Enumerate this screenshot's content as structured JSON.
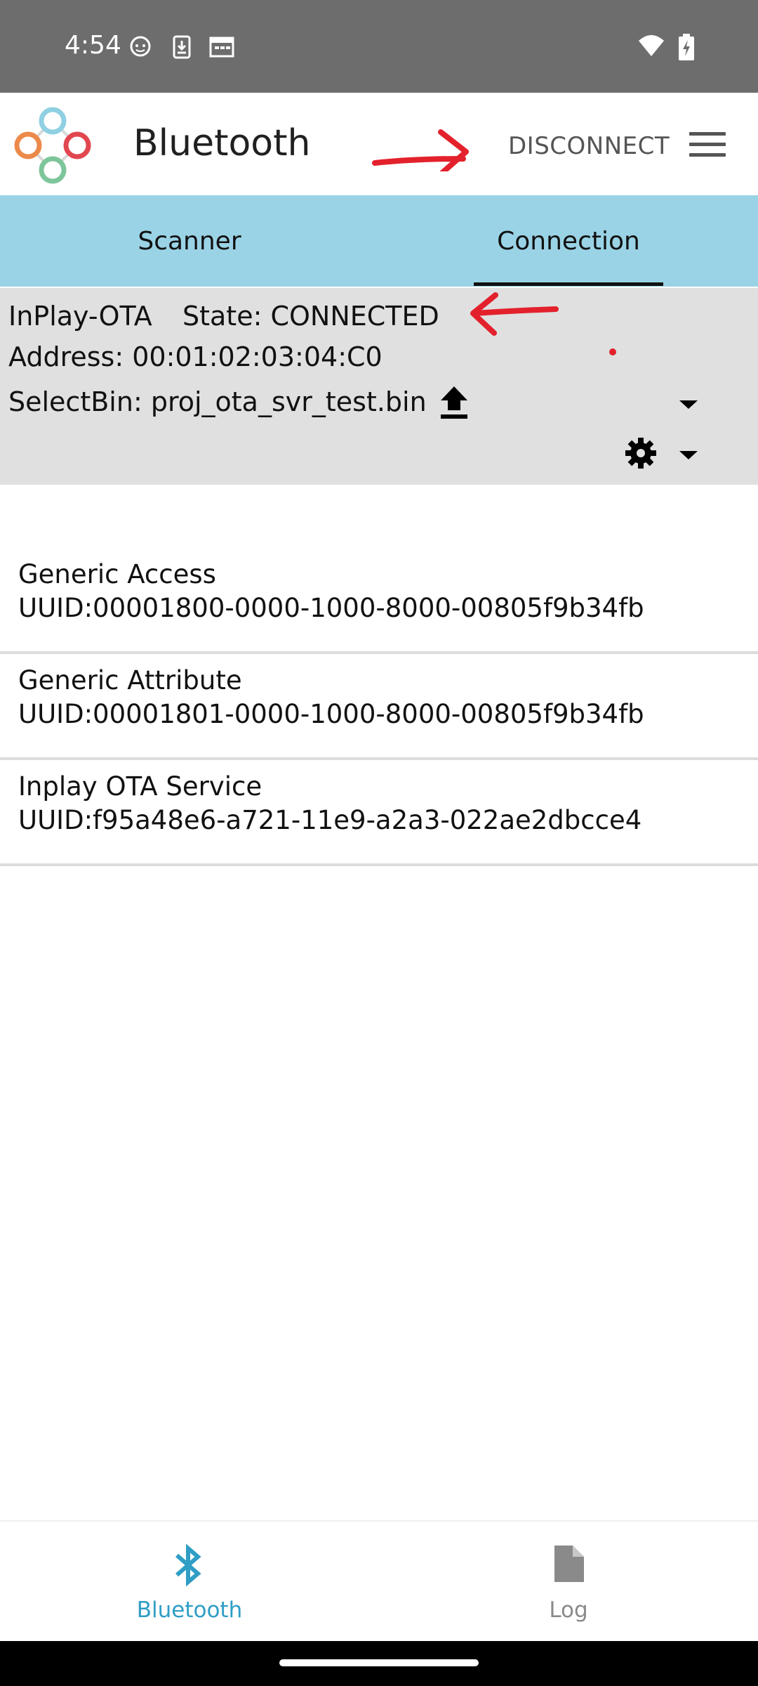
{
  "status_bar": {
    "time": "4:54",
    "icons_left": [
      "cat-notification-icon",
      "download-icon",
      "calendar-icon"
    ],
    "icons_right": [
      "wifi-icon",
      "battery-charging-icon"
    ]
  },
  "app_bar": {
    "title": "Bluetooth",
    "disconnect_label": "DISCONNECT",
    "menu_icon": "hamburger-menu-icon",
    "annotation_color": "#e3212c"
  },
  "tabs": [
    {
      "label": "Scanner",
      "selected": false
    },
    {
      "label": "Connection",
      "selected": true
    }
  ],
  "connection": {
    "device_name": "InPlay-OTA",
    "state": "State: CONNECTED",
    "address": "Address: 00:01:02:03:04:C0",
    "select_bin": "SelectBin: proj_ota_svr_test.bin"
  },
  "services": [
    {
      "name": "Generic Access",
      "uuid": "UUID:00001800-0000-1000-8000-00805f9b34fb"
    },
    {
      "name": "Generic Attribute",
      "uuid": "UUID:00001801-0000-1000-8000-00805f9b34fb"
    },
    {
      "name": "Inplay OTA Service",
      "uuid": "UUID:f95a48e6-a721-11e9-a2a3-022ae2dbcce4"
    }
  ],
  "bottom_nav": [
    {
      "label": "Bluetooth",
      "icon": "bluetooth-icon",
      "selected": true
    },
    {
      "label": "Log",
      "icon": "document-icon",
      "selected": false
    }
  ],
  "colors": {
    "status_bar": "#6d6d6d",
    "tab_bar": "#9ad3e6",
    "info_panel": "#e0e0e0",
    "accent": "#2f9ec5"
  }
}
